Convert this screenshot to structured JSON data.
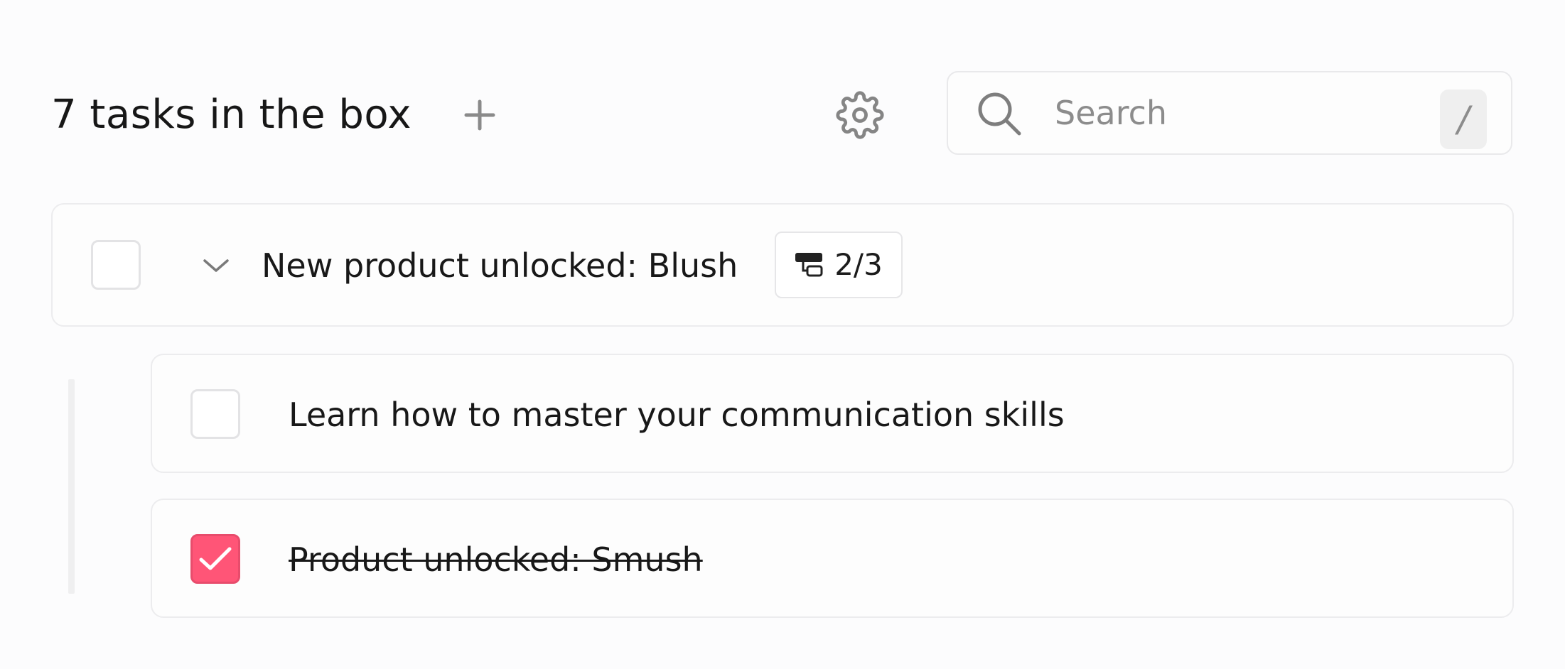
{
  "header": {
    "title": "7 tasks in the box",
    "add_icon": "plus-icon",
    "settings_icon": "gear-icon"
  },
  "search": {
    "placeholder": "Search",
    "value": "",
    "icon": "search-icon",
    "shortcut_hint": "/"
  },
  "tasks": [
    {
      "label": "New product unlocked: Blush",
      "completed": false,
      "expanded": true,
      "subtask_progress": "2/3",
      "subtask_icon": "subtasks-icon",
      "subtasks": [
        {
          "label": "Learn how to master your communication skills",
          "completed": false
        },
        {
          "label": "Product unlocked: Smush",
          "completed": true
        }
      ]
    }
  ],
  "colors": {
    "checked_accent": "#ff5577",
    "text": "#181818",
    "muted": "#8c8c8c",
    "border": "#ececee"
  }
}
